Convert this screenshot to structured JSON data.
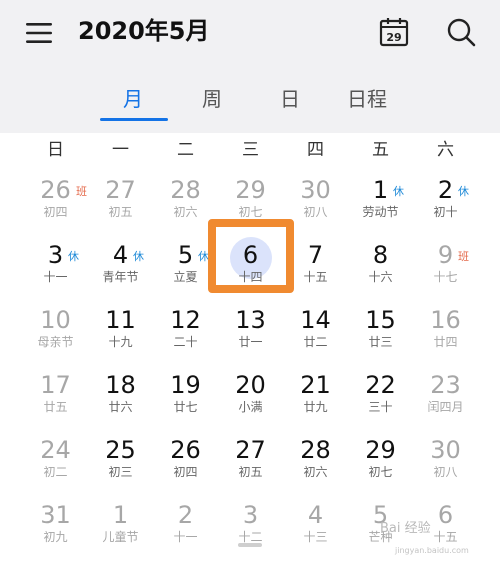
{
  "header": {
    "title": "2020年5月",
    "calendar_day": "29"
  },
  "tabs": [
    {
      "label": "月",
      "active": true
    },
    {
      "label": "周",
      "active": false
    },
    {
      "label": "日",
      "active": false
    },
    {
      "label": "日程",
      "active": false
    }
  ],
  "weekdays": [
    "日",
    "一",
    "二",
    "三",
    "四",
    "五",
    "六"
  ],
  "weeks": [
    [
      {
        "day": "26",
        "lunar": "初四",
        "muted": true,
        "badge": "班",
        "badge_type": "work"
      },
      {
        "day": "27",
        "lunar": "初五",
        "muted": true
      },
      {
        "day": "28",
        "lunar": "初六",
        "muted": true
      },
      {
        "day": "29",
        "lunar": "初七",
        "muted": true
      },
      {
        "day": "30",
        "lunar": "初八",
        "muted": true
      },
      {
        "day": "1",
        "lunar": "劳动节",
        "badge": "休",
        "badge_type": "rest"
      },
      {
        "day": "2",
        "lunar": "初十",
        "badge": "休",
        "badge_type": "rest"
      }
    ],
    [
      {
        "day": "3",
        "lunar": "十一",
        "badge": "休",
        "badge_type": "rest"
      },
      {
        "day": "4",
        "lunar": "青年节",
        "badge": "休",
        "badge_type": "rest"
      },
      {
        "day": "5",
        "lunar": "立夏",
        "badge": "休",
        "badge_type": "rest"
      },
      {
        "day": "6",
        "lunar": "十四",
        "today": true
      },
      {
        "day": "7",
        "lunar": "十五"
      },
      {
        "day": "8",
        "lunar": "十六"
      },
      {
        "day": "9",
        "lunar": "十七",
        "muted": true,
        "badge": "班",
        "badge_type": "work"
      }
    ],
    [
      {
        "day": "10",
        "lunar": "母亲节",
        "muted": true
      },
      {
        "day": "11",
        "lunar": "十九"
      },
      {
        "day": "12",
        "lunar": "二十"
      },
      {
        "day": "13",
        "lunar": "廿一"
      },
      {
        "day": "14",
        "lunar": "廿二"
      },
      {
        "day": "15",
        "lunar": "廿三"
      },
      {
        "day": "16",
        "lunar": "廿四",
        "muted": true
      }
    ],
    [
      {
        "day": "17",
        "lunar": "廿五",
        "muted": true
      },
      {
        "day": "18",
        "lunar": "廿六"
      },
      {
        "day": "19",
        "lunar": "廿七"
      },
      {
        "day": "20",
        "lunar": "小满"
      },
      {
        "day": "21",
        "lunar": "廿九"
      },
      {
        "day": "22",
        "lunar": "三十"
      },
      {
        "day": "23",
        "lunar": "闰四月",
        "muted": true
      }
    ],
    [
      {
        "day": "24",
        "lunar": "初二",
        "muted": true
      },
      {
        "day": "25",
        "lunar": "初三"
      },
      {
        "day": "26",
        "lunar": "初四"
      },
      {
        "day": "27",
        "lunar": "初五"
      },
      {
        "day": "28",
        "lunar": "初六"
      },
      {
        "day": "29",
        "lunar": "初七"
      },
      {
        "day": "30",
        "lunar": "初八",
        "muted": true
      }
    ],
    [
      {
        "day": "31",
        "lunar": "初九",
        "muted": true
      },
      {
        "day": "1",
        "lunar": "儿童节",
        "muted": true
      },
      {
        "day": "2",
        "lunar": "十一",
        "muted": true
      },
      {
        "day": "3",
        "lunar": "十二",
        "muted": true
      },
      {
        "day": "4",
        "lunar": "十三",
        "muted": true
      },
      {
        "day": "5",
        "lunar": "芒种",
        "muted": true
      },
      {
        "day": "6",
        "lunar": "十五",
        "muted": true
      }
    ]
  ],
  "watermark": {
    "text": "Bai 经验",
    "subtext": "jingyan.baidu.com"
  },
  "colors": {
    "accent": "#1473e6",
    "highlight": "#f08a30",
    "rest": "#1e8ad8",
    "work": "#e46a4b",
    "today_bg": "#dbe3fb"
  }
}
